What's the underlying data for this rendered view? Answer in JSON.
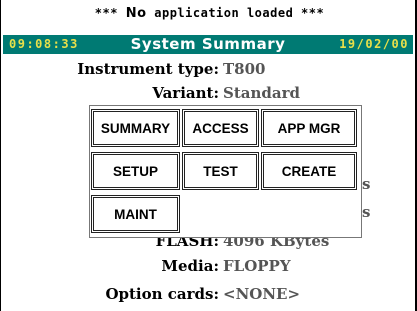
{
  "status_message": {
    "prefix": "***",
    "highlight": "No",
    "text": "application loaded",
    "suffix": "***"
  },
  "header": {
    "time": "09:08:33",
    "title": "System Summary",
    "date": "19/02/00"
  },
  "summary": {
    "instrument_type": {
      "label": "Instrument type:",
      "value": "T800"
    },
    "variant": {
      "label": "Variant:",
      "value": "Standard"
    },
    "memory_fragments": [
      {
        "value": "s"
      },
      {
        "value": "s"
      }
    ],
    "flash": {
      "label": "FLASH:",
      "value": "4096 KBytes"
    },
    "media": {
      "label": "Media:",
      "value": "FLOPPY"
    },
    "option_cards": {
      "label": "Option cards:",
      "value": "<NONE>"
    }
  },
  "menu": {
    "items": [
      "SUMMARY",
      "ACCESS",
      "APP MGR",
      "SETUP",
      "TEST",
      "CREATE",
      "MAINT"
    ]
  },
  "colors": {
    "titlebar_bg": "#007a73",
    "titlebar_accent": "#e8e04a",
    "value_text": "#555555"
  }
}
